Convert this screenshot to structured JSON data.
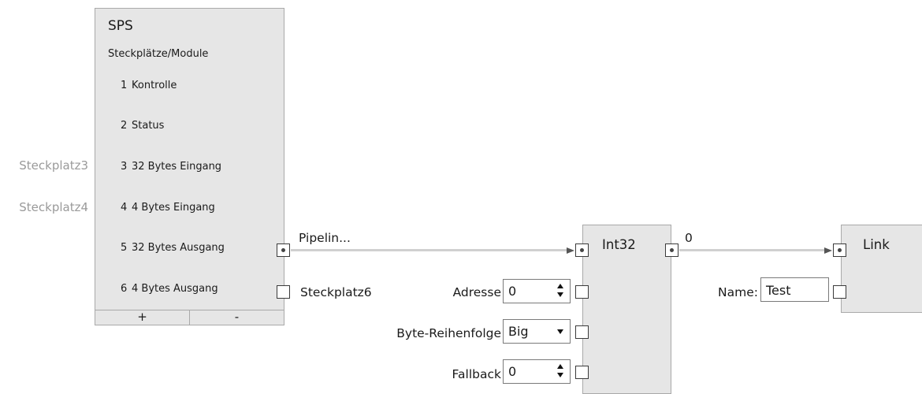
{
  "sps": {
    "title": "SPS",
    "subtitle": "Steckplätze/Module",
    "slots": [
      {
        "num": "1",
        "name": "Kontrolle"
      },
      {
        "num": "2",
        "name": "Status"
      },
      {
        "num": "3",
        "name": "32 Bytes Eingang"
      },
      {
        "num": "4",
        "name": "4 Bytes Eingang"
      },
      {
        "num": "5",
        "name": "32 Bytes Ausgang"
      },
      {
        "num": "6",
        "name": "4 Bytes Ausgang"
      }
    ],
    "add_label": "+",
    "remove_label": "-"
  },
  "side_labels": {
    "slot3": "Steckplatz3",
    "slot4": "Steckplatz4"
  },
  "wires": {
    "pipeline_label": "Pipelin...",
    "slot6_label": "Steckplatz6",
    "int_output_label": "0"
  },
  "int32_node": {
    "title": "Int32",
    "address_label": "Adresse",
    "address_value": "0",
    "byte_order_label": "Byte-Reihenfolge",
    "byte_order_value": "Big",
    "fallback_label": "Fallback",
    "fallback_value": "0"
  },
  "link_node": {
    "title": "Link",
    "name_label": "Name:",
    "name_value": "Test"
  }
}
